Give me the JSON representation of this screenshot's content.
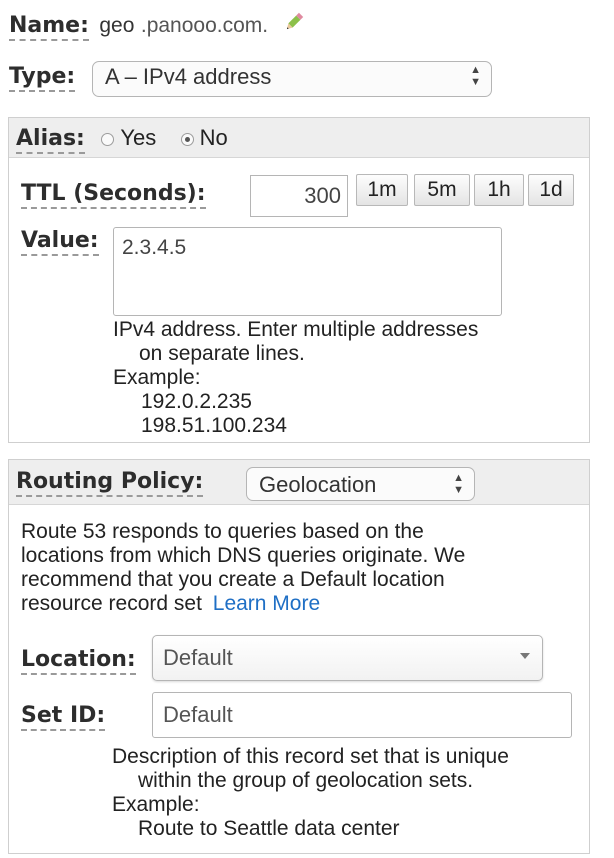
{
  "name": {
    "label": "Name:",
    "value": "geo",
    "domain": ".panooo.com.",
    "edit_icon": "pencil-icon"
  },
  "type": {
    "label": "Type:",
    "selected": "A – IPv4 address"
  },
  "alias": {
    "label": "Alias:",
    "options": [
      "Yes",
      "No"
    ],
    "selected": "No"
  },
  "ttl": {
    "label": "TTL (Seconds):",
    "value": "300",
    "presets": [
      "1m",
      "5m",
      "1h",
      "1d"
    ]
  },
  "value": {
    "label": "Value:",
    "text": "2.3.4.5",
    "help_line1": "IPv4 address. Enter multiple addresses",
    "help_line2": "on separate lines.",
    "example_label": "Example:",
    "examples": [
      "192.0.2.235",
      "198.51.100.234"
    ]
  },
  "routing": {
    "label": "Routing Policy:",
    "selected": "Geolocation",
    "description_lines": [
      "Route 53 responds to queries based on the",
      "locations from which DNS queries originate. We",
      "recommend that you create a Default location",
      "resource record set"
    ],
    "learn_more": "Learn More"
  },
  "location": {
    "label": "Location:",
    "selected": "Default"
  },
  "set_id": {
    "label": "Set ID:",
    "value": "Default",
    "help_line1": "Description of this record set that is unique",
    "help_line2": "within the group of geolocation sets.",
    "example_label": "Example:",
    "example": "Route to Seattle data center"
  },
  "colors": {
    "link": "#1f6fc5",
    "section_header": "#eeeeee",
    "label_underline": "#9a9a9a"
  }
}
